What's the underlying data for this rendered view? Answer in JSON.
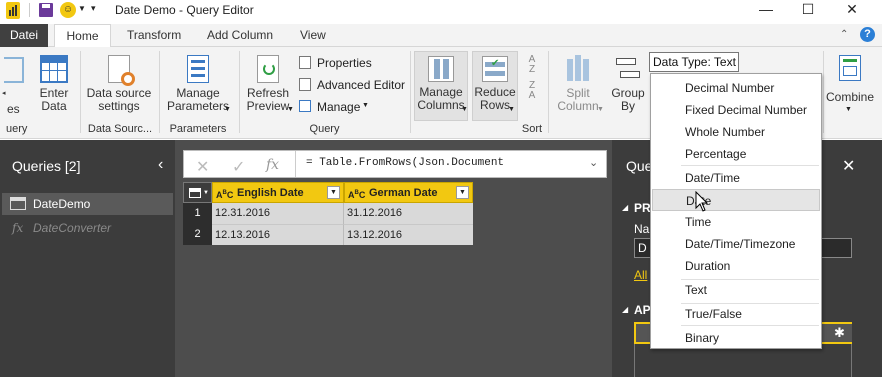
{
  "window": {
    "title": "Date Demo - Query Editor",
    "minimize": "—",
    "maximize": "☐",
    "close": "✕"
  },
  "tabs": {
    "datei": "Datei",
    "home": "Home",
    "transform": "Transform",
    "add_column": "Add Column",
    "view": "View",
    "help": "?"
  },
  "ribbon": {
    "partial_es": "es",
    "partial_uery": "uery",
    "enter_data": [
      "Enter",
      "Data"
    ],
    "data_source_settings": [
      "Data source",
      "settings"
    ],
    "data_sources_group": "Data Sourc...",
    "manage_parameters": [
      "Manage",
      "Parameters"
    ],
    "parameters_group": "Parameters",
    "refresh_preview": [
      "Refresh",
      "Preview"
    ],
    "properties": "Properties",
    "advanced_editor": "Advanced Editor",
    "manage": "Manage",
    "query_group": "Query",
    "manage_columns": [
      "Manage",
      "Columns"
    ],
    "reduce_rows": [
      "Reduce",
      "Rows"
    ],
    "sort_group": "Sort",
    "split_column": [
      "Split",
      "Column"
    ],
    "group_by": [
      "Group",
      "By"
    ],
    "data_type": "Data Type: Text",
    "combine": "Combine"
  },
  "queries": {
    "header": "Queries [2]",
    "items": [
      {
        "name": "DateDemo",
        "selected": true
      },
      {
        "name": "DateConverter",
        "selected": false
      }
    ]
  },
  "formula": {
    "text": "= Table.FromRows(Json.Document"
  },
  "table": {
    "columns": [
      "English Date",
      "German Date"
    ],
    "rows": [
      {
        "n": "1",
        "english": "12.31.2016",
        "german": "31.12.2016"
      },
      {
        "n": "2",
        "english": "12.13.2016",
        "german": "13.12.2016"
      }
    ]
  },
  "right_pane": {
    "title": "Que",
    "close": "✕",
    "section1": "PR",
    "name_label": "Na",
    "name_value": "D",
    "all_link": "All",
    "section2": "AP"
  },
  "data_type_menu": {
    "items": [
      "Decimal Number",
      "Fixed Decimal Number",
      "Whole Number",
      "Percentage",
      "Date/Time",
      "Date",
      "Time",
      "Date/Time/Timezone",
      "Duration",
      "Text",
      "True/False",
      "Binary"
    ],
    "hovered": "Date"
  },
  "colors": {
    "dark_pane": "#3c3c3c",
    "center_bg": "#4d4d4d",
    "header_yellow": "#f2c811",
    "ribbon_bg": "#f3f3f3",
    "link_yellow": "#f2c811"
  }
}
